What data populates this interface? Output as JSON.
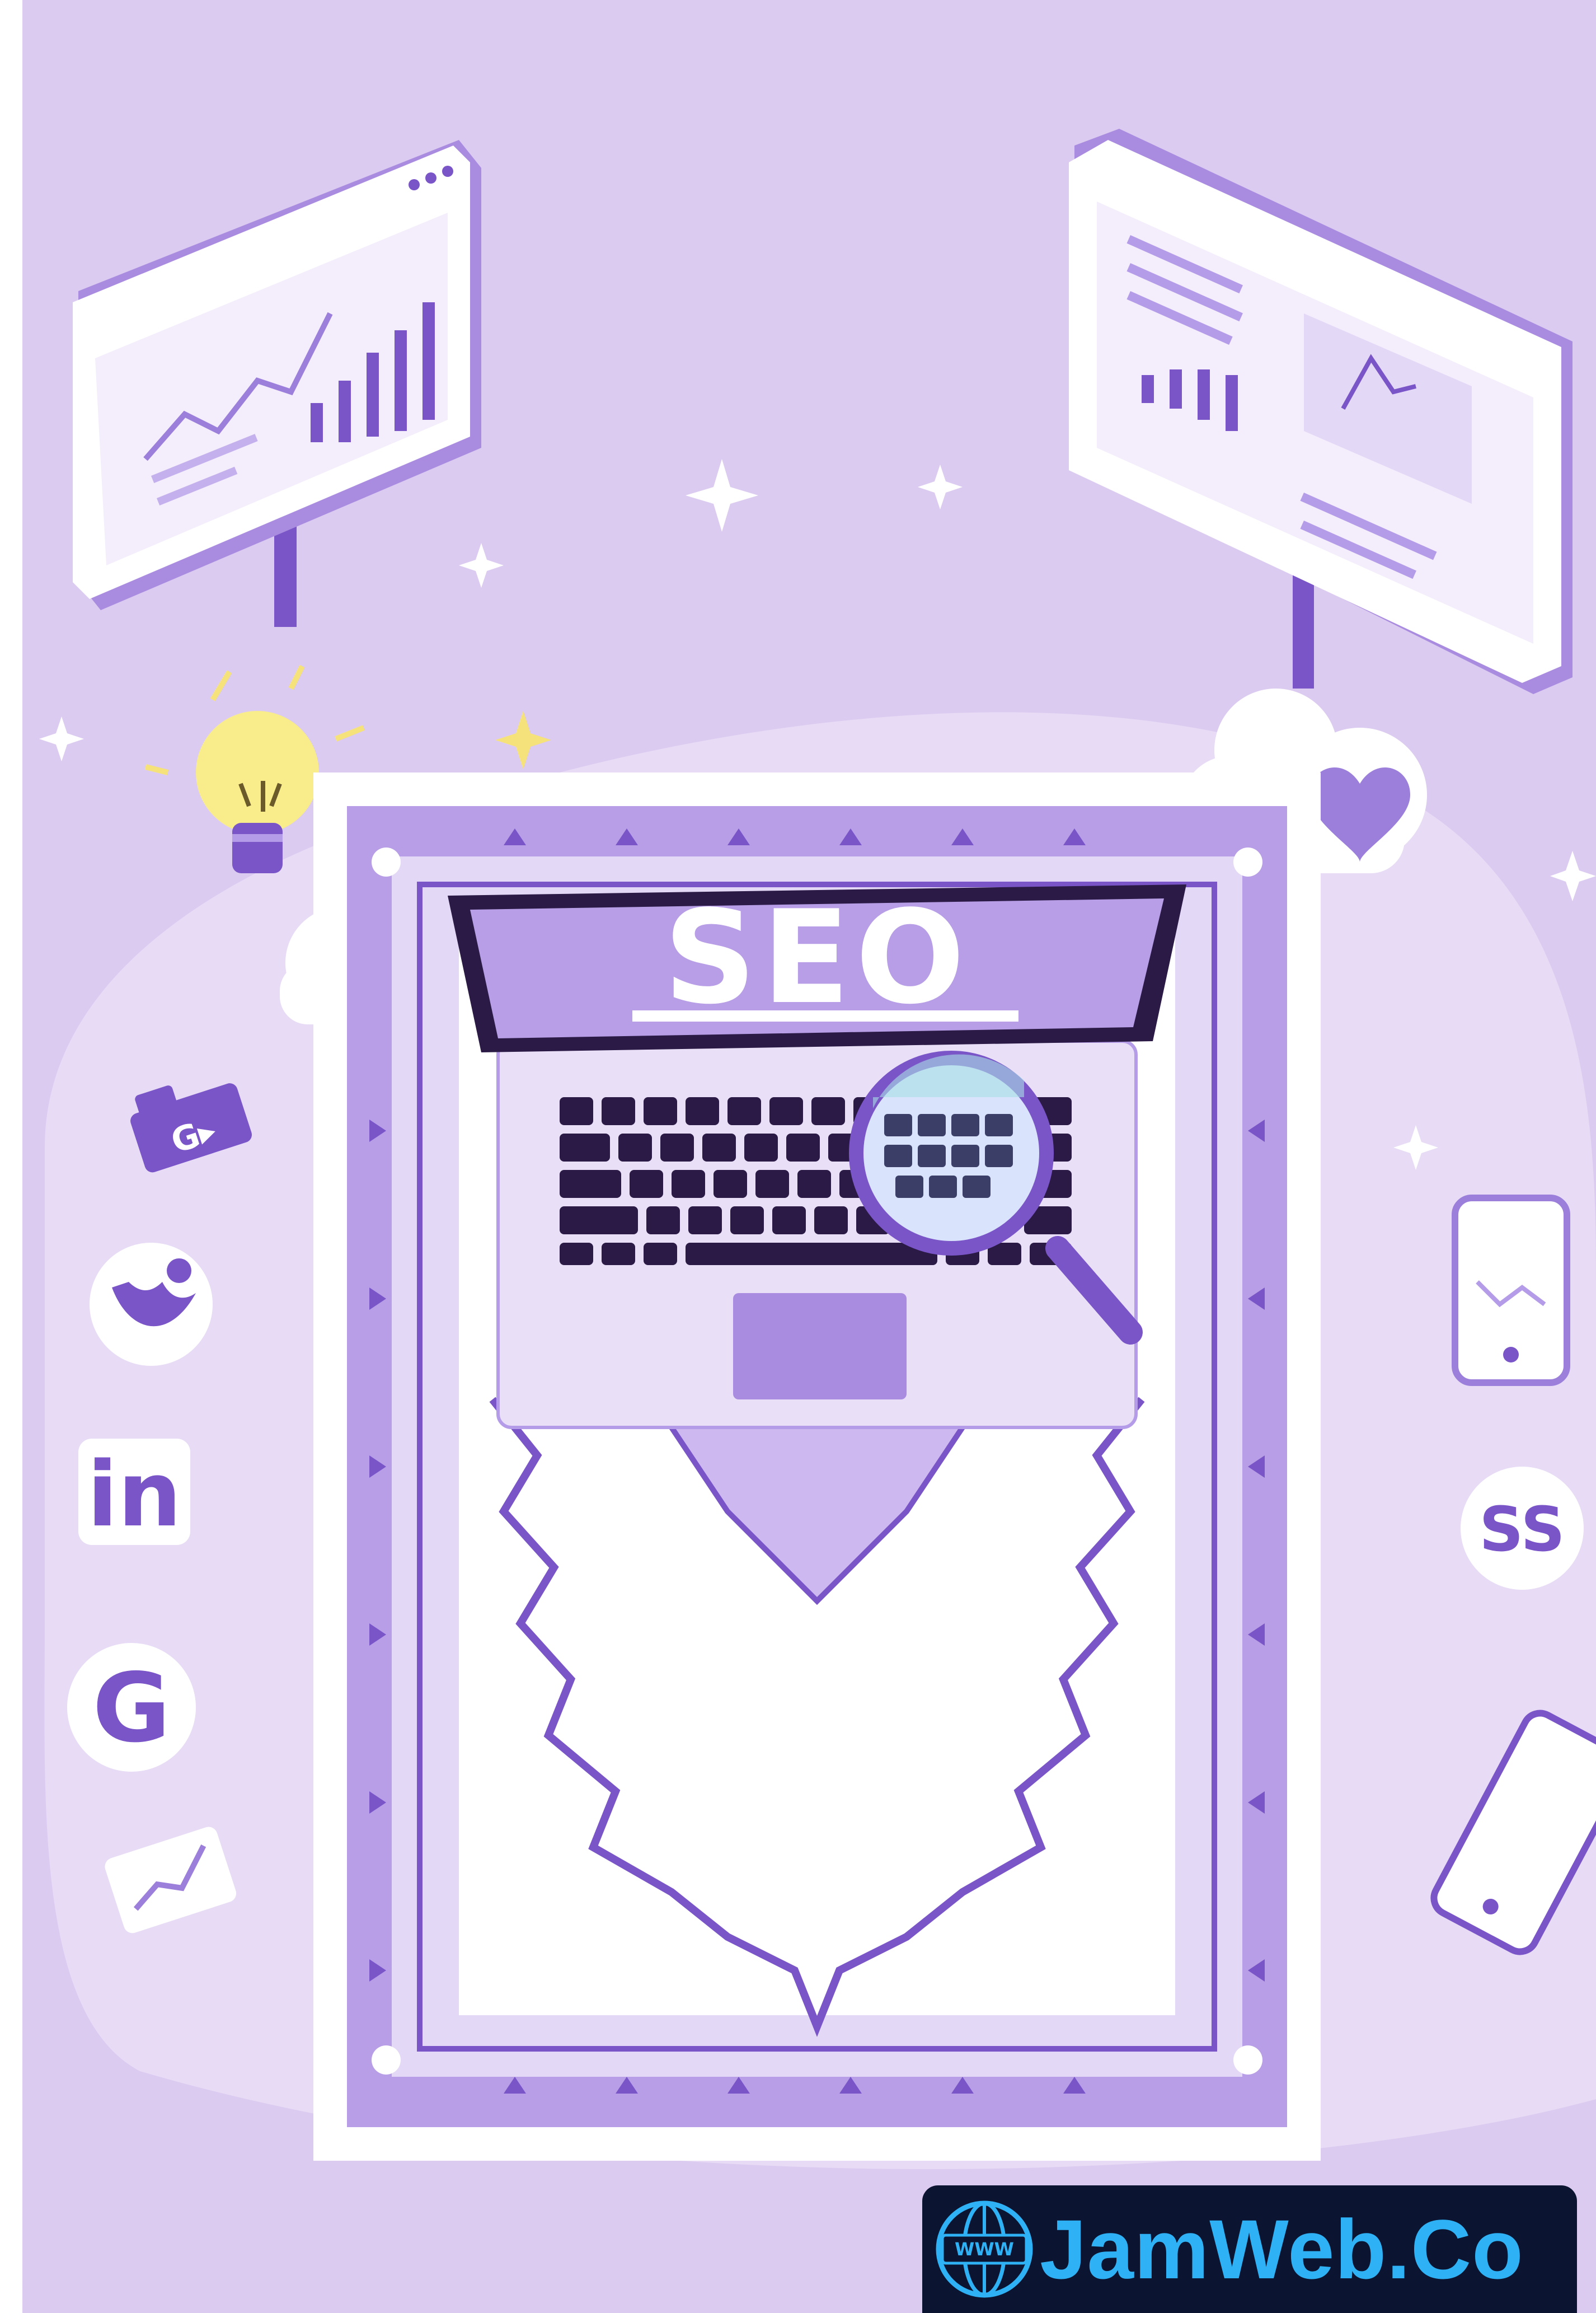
{
  "laptop": {
    "screen_text": "SEO"
  },
  "social_icons": {
    "linkedin": "in",
    "google": "G",
    "ss_circle": "SS",
    "folder_tag": "G▸"
  },
  "brand": {
    "name": "JamWeb.Co",
    "globe_label": "WWW"
  },
  "colors": {
    "background": "#dccbf0",
    "accent": "#7a55c8",
    "rug": "#b79ee6",
    "badge_bg": "#0b1430",
    "badge_text": "#2fb2f5"
  },
  "icons": [
    "line-chart-icon",
    "bar-chart-icon",
    "lightbulb-icon",
    "heart-icon",
    "magnifier-icon",
    "smartphone-icon",
    "twitter-icon",
    "linkedin-icon",
    "google-icon",
    "globe-icon"
  ]
}
